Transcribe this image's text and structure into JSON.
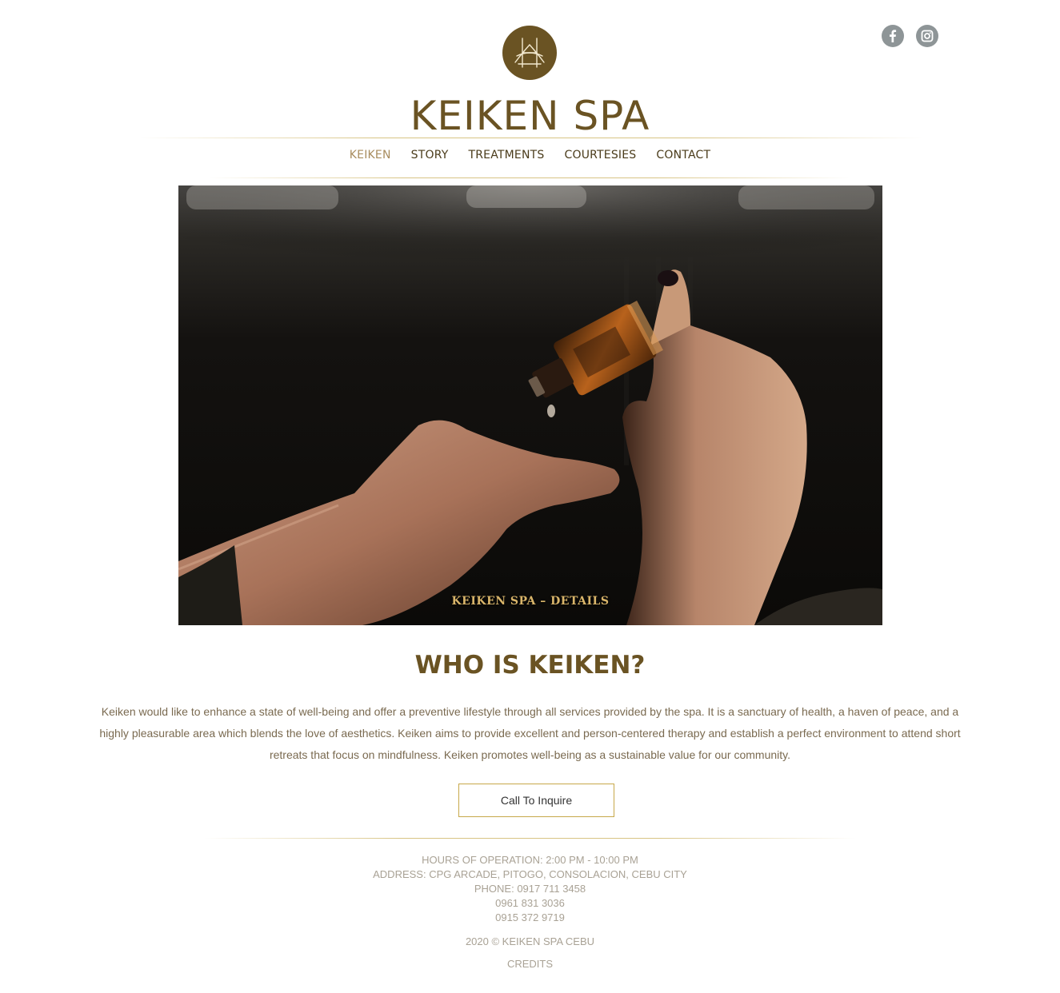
{
  "brand": {
    "title": "KEIKEN SPA"
  },
  "social": {
    "facebook_icon": "facebook-icon",
    "instagram_icon": "instagram-icon"
  },
  "nav": {
    "items": [
      {
        "label": "KEIKEN",
        "active": true
      },
      {
        "label": "STORY",
        "active": false
      },
      {
        "label": "TREATMENTS",
        "active": false
      },
      {
        "label": "COURTESIES",
        "active": false
      },
      {
        "label": "CONTACT",
        "active": false
      }
    ]
  },
  "hero": {
    "caption": "KEIKEN SPA – DETAILS"
  },
  "about": {
    "title": "WHO IS KEIKEN?",
    "body": "Keiken would like to enhance a state of well-being and offer a preventive lifestyle through all services provided by the spa. It is a sanctuary of health, a haven of peace, and a highly pleasurable area which blends the love of aesthetics. Keiken aims to provide excellent and person-centered therapy and establish a perfect environment to attend short retreats that focus on mindfulness. Keiken promotes well-being as a sustainable value for our community.",
    "cta_label": "Call To Inquire"
  },
  "footer": {
    "hours": "HOURS OF OPERATION: 2:00 PM - 10:00 PM",
    "address": "ADDRESS: CPG ARCADE, PITOGO, CONSOLACION, CEBU CITY",
    "phone": "PHONE: 0917 711 3458",
    "phone2": "0961 831 3036",
    "phone3": "0915 372 9719",
    "copyright": "2020 © KEIKEN SPA CEBU",
    "credits": "CREDITS"
  },
  "colors": {
    "brand_brown": "#6a5323",
    "accent_gold": "#c7a84a",
    "nav_active": "#a88c5e",
    "social_grey": "#8e9597"
  }
}
